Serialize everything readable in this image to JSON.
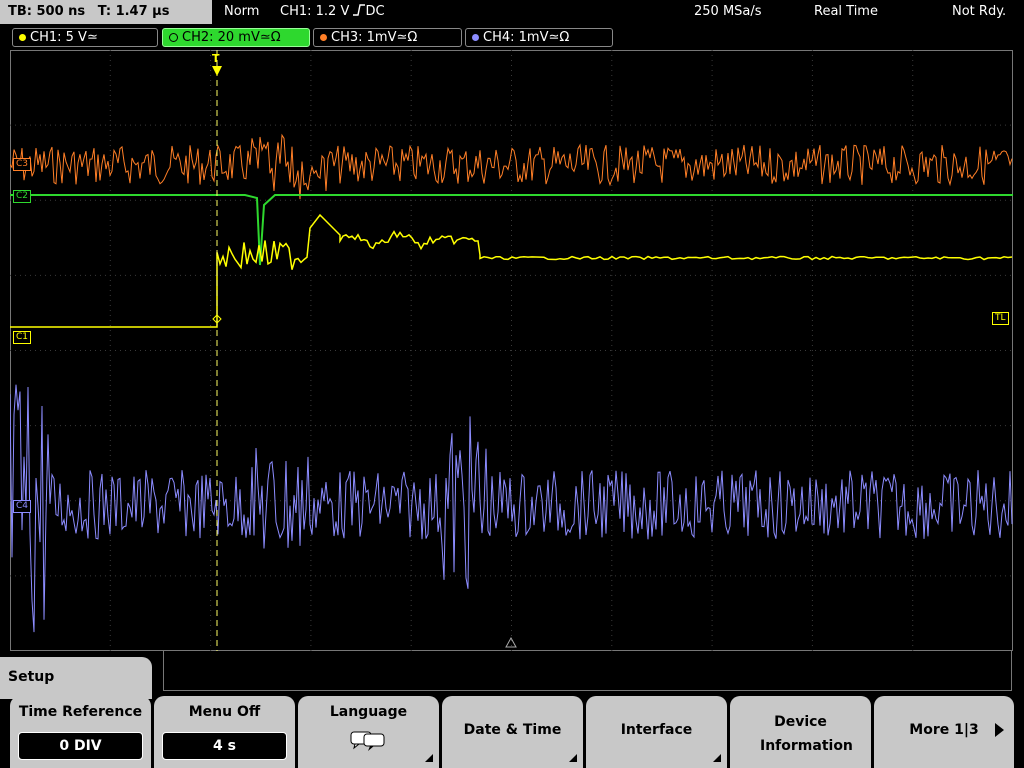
{
  "status": {
    "timebase": "TB: 500 ns",
    "trigger_pos": "T: 1.47 µs",
    "trigger_mode": "Norm",
    "trigger_info": "CH1: 1.2 V",
    "coupling": "DC",
    "sample_rate": "250 MSa/s",
    "acq_mode": "Real Time",
    "acq_state": "Not Rdy."
  },
  "channels": [
    {
      "label": "CH1: 5 V",
      "coupling_sym": "≃",
      "color": "#ffff00"
    },
    {
      "label": "CH2: 20 mV",
      "coupling_sym": "≃Ω",
      "color": "#2ed82e"
    },
    {
      "label": "CH3: 1mV",
      "coupling_sym": "≃Ω",
      "color": "#ff7f27"
    },
    {
      "label": "CH4: 1mV",
      "coupling_sym": "≃Ω",
      "color": "#8c8cff"
    }
  ],
  "markers": {
    "c3": "C3",
    "c2": "C2",
    "c1": "C1",
    "c4": "C4",
    "tl": "TL",
    "trigger_marker": "T"
  },
  "menu": {
    "title": "Setup",
    "softkeys": [
      {
        "label": "Time Reference",
        "value": "0 DIV"
      },
      {
        "label": "Menu Off",
        "value": "4 s"
      },
      {
        "label": "Language",
        "icon": "speech-bubble-icon"
      },
      {
        "label": "Date & Time"
      },
      {
        "label": "Interface"
      },
      {
        "label": "Device Information"
      },
      {
        "label": "More 1|3"
      }
    ]
  }
}
